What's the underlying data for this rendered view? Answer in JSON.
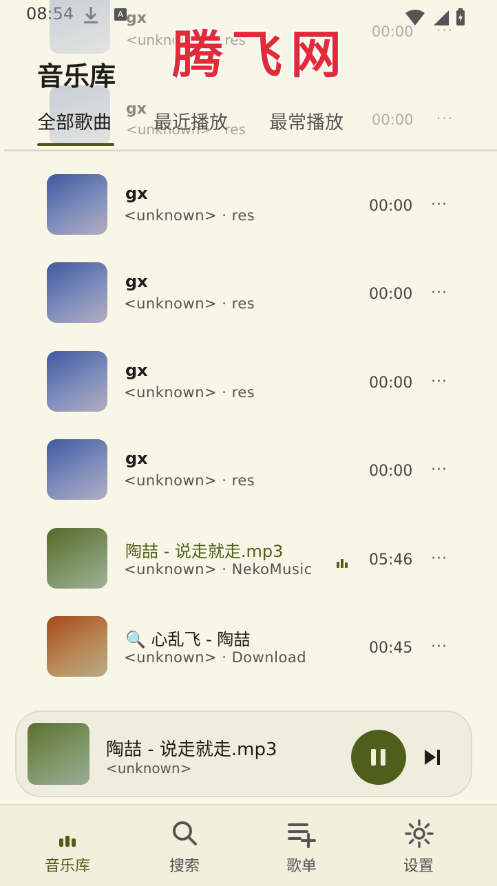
{
  "status": {
    "time": "08:54",
    "a_badge": "A"
  },
  "watermark": "腾飞网",
  "ghost_rows": [
    {
      "title": "gx",
      "subtitle": "<unknown> · res",
      "duration": "00:00",
      "more": "···"
    },
    {
      "title": "gx",
      "subtitle": "<unknown> · res",
      "duration": "00:00",
      "more": "···"
    }
  ],
  "page": {
    "title": "音乐库"
  },
  "tabs": [
    {
      "label": "全部歌曲"
    },
    {
      "label": "最近播放"
    },
    {
      "label": "最常播放"
    }
  ],
  "songs": [
    {
      "title": "gx",
      "subtitle": "<unknown> · res",
      "duration": "00:00",
      "more": "···"
    },
    {
      "title": "gx",
      "subtitle": "<unknown> · res",
      "duration": "00:00",
      "more": "···"
    },
    {
      "title": "gx",
      "subtitle": "<unknown> · res",
      "duration": "00:00",
      "more": "···"
    },
    {
      "title": "gx",
      "subtitle": "<unknown> · res",
      "duration": "00:00",
      "more": "···"
    },
    {
      "title": "陶喆 - 说走就走.mp3",
      "subtitle": "<unknown> · NekoMusic",
      "duration": "05:46",
      "more": "···"
    },
    {
      "title": "🔍 心乱飞 - 陶喆",
      "subtitle": "<unknown> · Download",
      "duration": "00:45",
      "more": "···"
    }
  ],
  "now_playing": {
    "title": "陶喆 - 说走就走.mp3",
    "artist": "<unknown>"
  },
  "nav": [
    {
      "label": "音乐库"
    },
    {
      "label": "搜索"
    },
    {
      "label": "歌单"
    },
    {
      "label": "设置"
    }
  ],
  "colors": {
    "background": "#f8f6e6",
    "accent": "#4f5f1b",
    "watermark": "#e22b3a"
  }
}
